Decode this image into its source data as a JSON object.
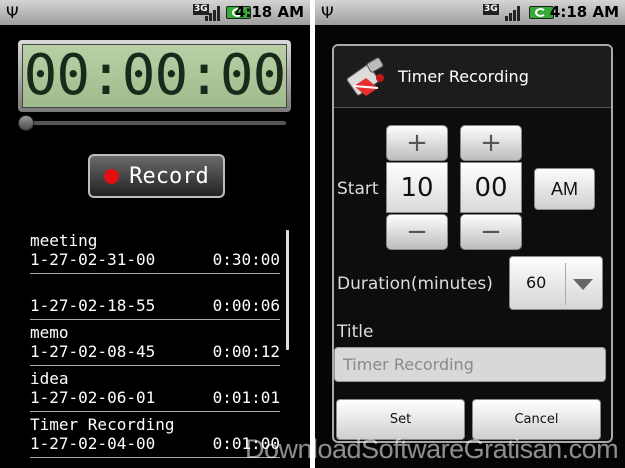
{
  "status_bar": {
    "usb": "Ψ",
    "network": "3G",
    "time": "4:18 AM",
    "battery_color": "#38a838"
  },
  "left": {
    "timer": "00:00:00",
    "record_label": "Record",
    "recordings": [
      {
        "name": "meeting",
        "date": "1-27-02-31-00",
        "duration": "0:30:00"
      },
      {
        "name": "",
        "date": "1-27-02-18-55",
        "duration": "0:00:06"
      },
      {
        "name": "memo",
        "date": "1-27-02-08-45",
        "duration": "0:00:12"
      },
      {
        "name": "idea",
        "date": "1-27-02-06-01",
        "duration": "0:01:01"
      },
      {
        "name": "Timer Recording",
        "date": "1-27-02-04-00",
        "duration": "0:01:00"
      }
    ]
  },
  "dialog": {
    "title": "Timer Recording",
    "start_label": "Start",
    "hour": "10",
    "minute": "00",
    "plus": "+",
    "minus": "−",
    "ampm": "AM",
    "duration_label": "Duration(minutes)",
    "duration_value": "60",
    "title_label": "Title",
    "title_placeholder": "Timer Recording",
    "set_label": "Set",
    "cancel_label": "Cancel"
  },
  "watermark": "DownloadSoftwareGratisan.com"
}
